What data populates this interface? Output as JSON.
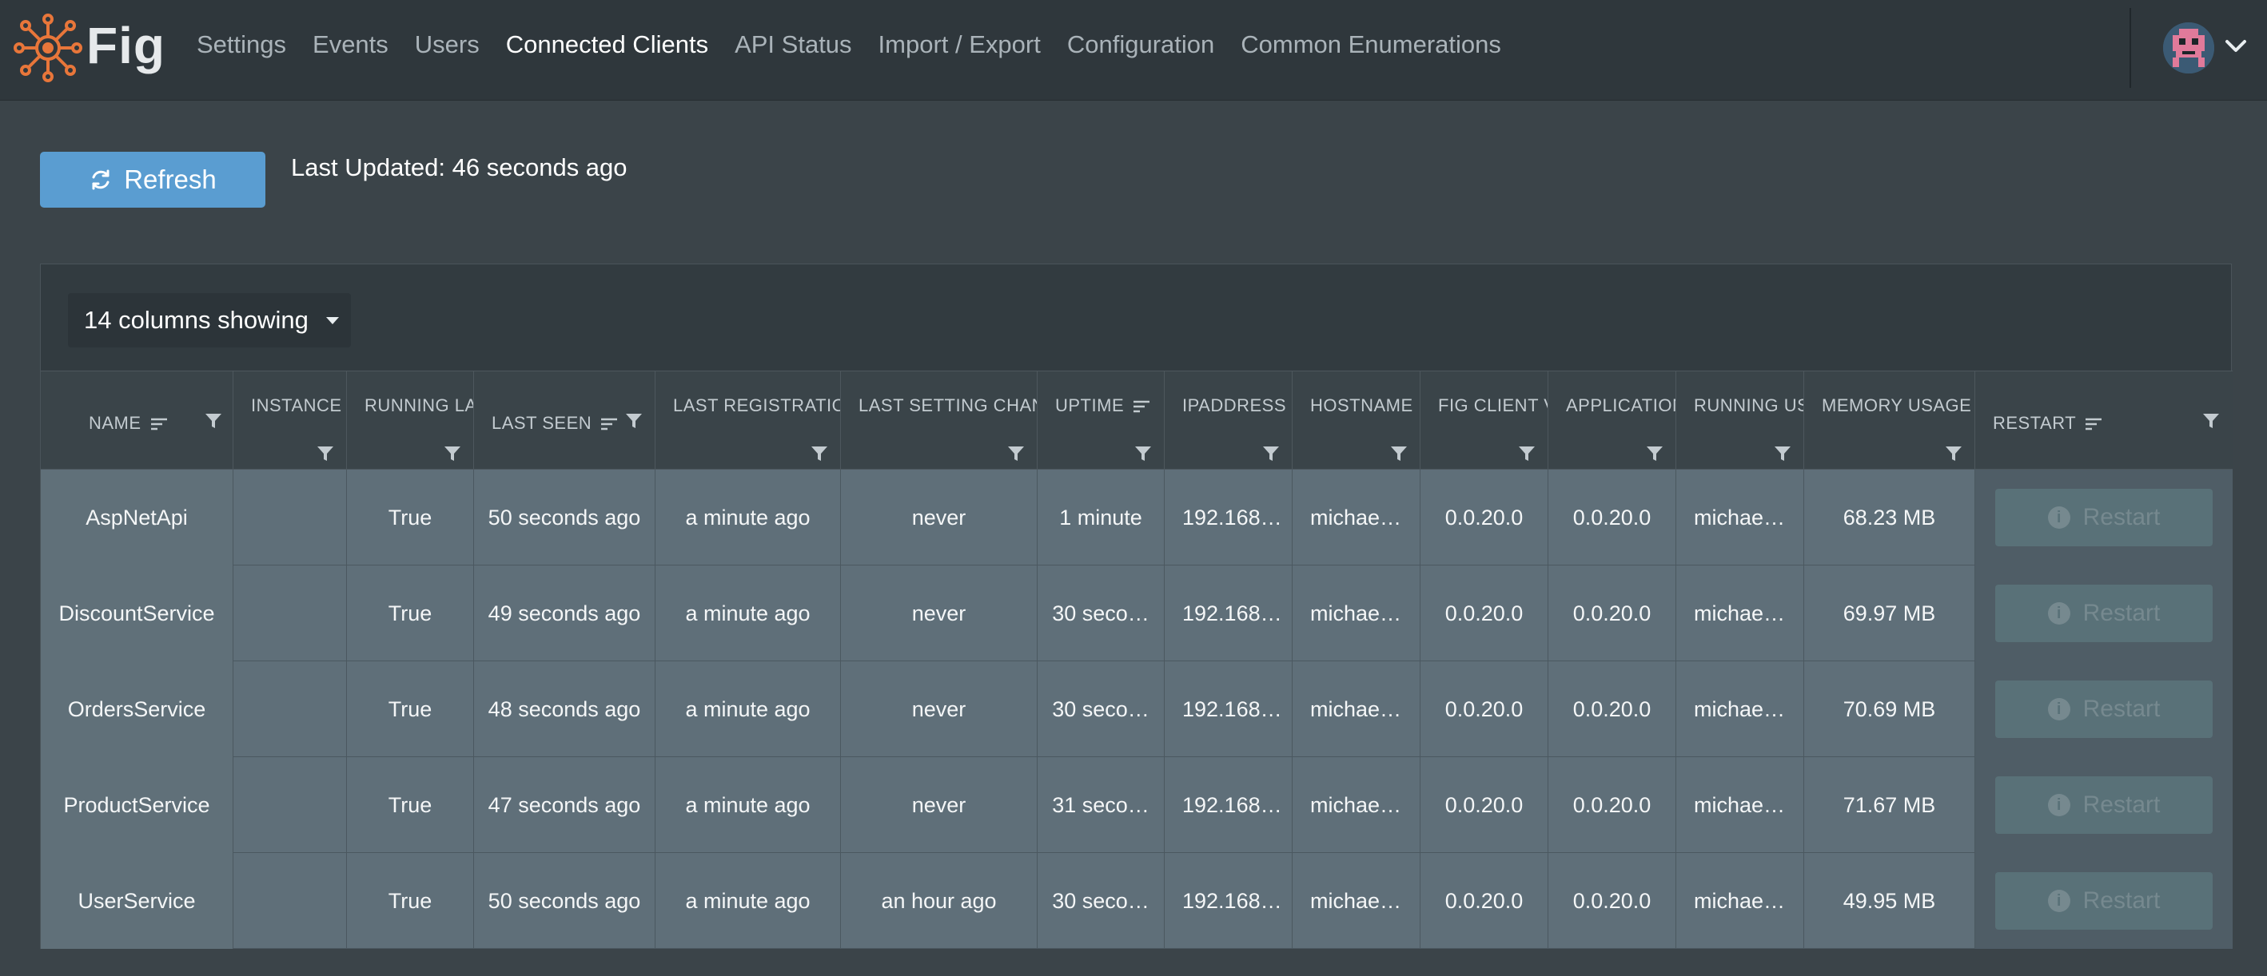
{
  "app": {
    "brand": "Fig"
  },
  "nav": {
    "items": [
      {
        "label": "Settings",
        "active": false
      },
      {
        "label": "Events",
        "active": false
      },
      {
        "label": "Users",
        "active": false
      },
      {
        "label": "Connected Clients",
        "active": true
      },
      {
        "label": "API Status",
        "active": false
      },
      {
        "label": "Import / Export",
        "active": false
      },
      {
        "label": "Configuration",
        "active": false
      },
      {
        "label": "Common Enumerations",
        "active": false
      }
    ]
  },
  "toolbar": {
    "refresh_label": "Refresh",
    "last_updated": "Last Updated: 46 seconds ago"
  },
  "grid": {
    "columns_showing": "14 columns showing",
    "headers": [
      "Name",
      "Instance",
      "Running Lat",
      "Last Seen",
      "Last Registration",
      "Last Setting Change",
      "Uptime",
      "IPAddress",
      "Hostname",
      "Fig Client Ve",
      "Application",
      "Running Use",
      "Memory Usage",
      "Restart"
    ],
    "restart_label": "Restart",
    "rows": [
      [
        "AspNetApi",
        "",
        "True",
        "50 seconds ago",
        "a minute ago",
        "never",
        "1 minute",
        "192.168…",
        "michae…",
        "0.0.20.0",
        "0.0.20.0",
        "michae…",
        "68.23 MB"
      ],
      [
        "DiscountService",
        "",
        "True",
        "49 seconds ago",
        "a minute ago",
        "never",
        "30 seco…",
        "192.168…",
        "michae…",
        "0.0.20.0",
        "0.0.20.0",
        "michae…",
        "69.97 MB"
      ],
      [
        "OrdersService",
        "",
        "True",
        "48 seconds ago",
        "a minute ago",
        "never",
        "30 seco…",
        "192.168…",
        "michae…",
        "0.0.20.0",
        "0.0.20.0",
        "michae…",
        "70.69 MB"
      ],
      [
        "ProductService",
        "",
        "True",
        "47 seconds ago",
        "a minute ago",
        "never",
        "31 seco…",
        "192.168…",
        "michae…",
        "0.0.20.0",
        "0.0.20.0",
        "michae…",
        "71.67 MB"
      ],
      [
        "UserService",
        "",
        "True",
        "50 seconds ago",
        "a minute ago",
        "an hour ago",
        "30 seco…",
        "192.168…",
        "michae…",
        "0.0.20.0",
        "0.0.20.0",
        "michae…",
        "49.95 MB"
      ]
    ]
  },
  "colors": {
    "accent": "#5a9dd1",
    "logo": "#e8763a",
    "topbar": "#2f373c",
    "background": "#3b4449"
  }
}
